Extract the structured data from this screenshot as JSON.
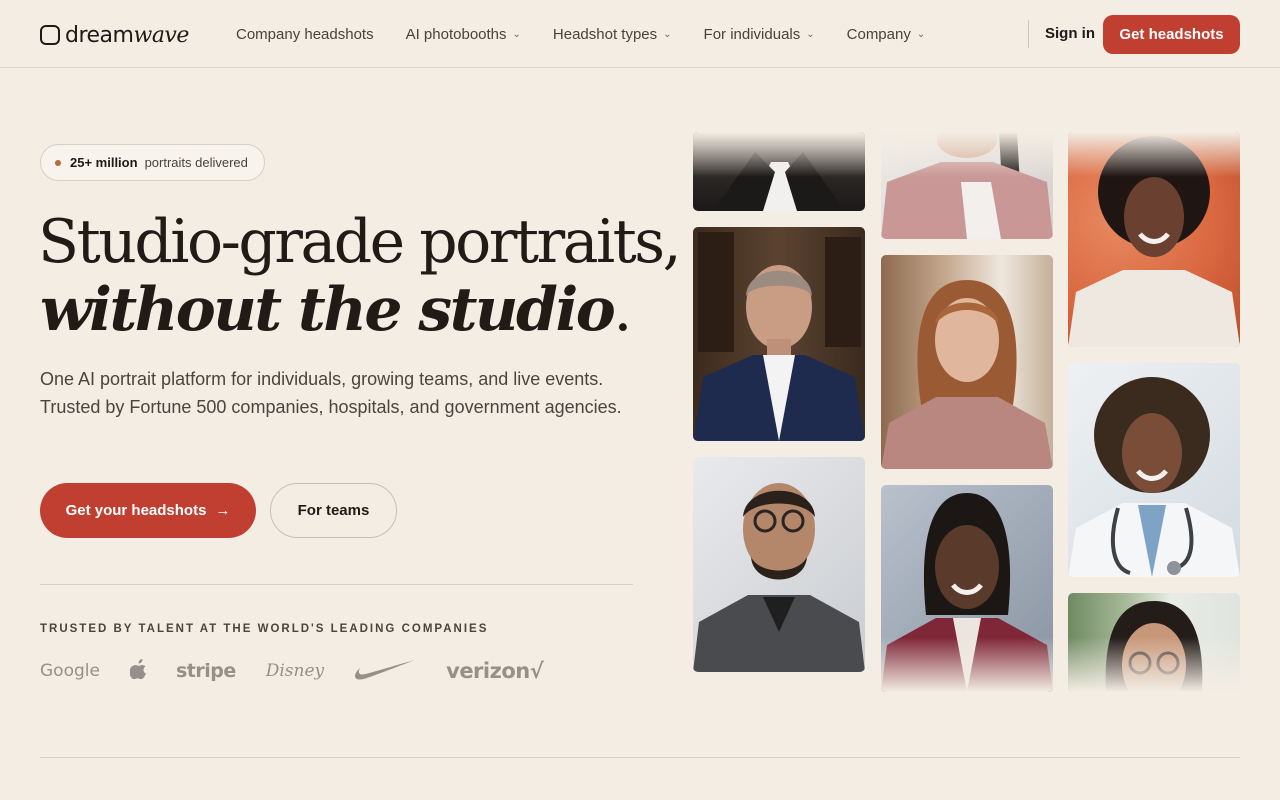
{
  "brand": {
    "name_part1": "dream",
    "name_part2": "wave"
  },
  "nav": {
    "links": [
      {
        "label": "Company headshots",
        "dropdown": false
      },
      {
        "label": "AI photobooths",
        "dropdown": true
      },
      {
        "label": "Headshot types",
        "dropdown": true
      },
      {
        "label": "For individuals",
        "dropdown": true
      },
      {
        "label": "Company",
        "dropdown": true
      }
    ],
    "signin": "Sign in",
    "cta": "Get headshots"
  },
  "hero": {
    "badge_strong": "25+ million",
    "badge_text": "portraits delivered",
    "headline_line1": "Studio-grade portraits,",
    "headline_line2": "without the studio",
    "headline_period": ".",
    "subtext": "One AI portrait platform for individuals, growing teams, and live events. Trusted by Fortune 500 companies, hospitals, and government agencies.",
    "primary_cta": "Get your headshots",
    "primary_arrow": "→",
    "secondary_cta": "For teams"
  },
  "trusted": {
    "heading": "TRUSTED BY TALENT AT THE WORLD'S LEADING COMPANIES",
    "logos": [
      {
        "name": "Google",
        "text": "Google"
      },
      {
        "name": "Apple",
        "text": ""
      },
      {
        "name": "Stripe",
        "text": "stripe"
      },
      {
        "name": "Disney",
        "text": "Disney"
      },
      {
        "name": "Nike",
        "text": ""
      },
      {
        "name": "Verizon",
        "text": "verizon√"
      }
    ]
  },
  "colors": {
    "background": "#f3ede4",
    "accent": "#c13f30",
    "text_dark": "#211b17",
    "text_muted": "#4c443d"
  }
}
